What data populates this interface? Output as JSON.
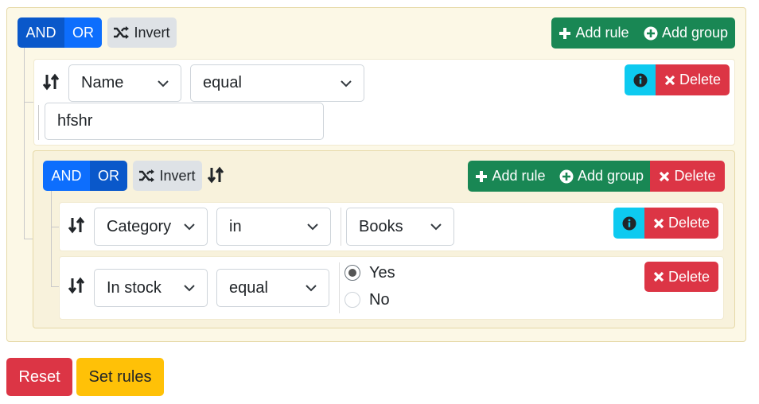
{
  "outer_group": {
    "combinators": [
      "AND",
      "OR"
    ],
    "invert_label": "Invert",
    "add_rule_label": "Add rule",
    "add_group_label": "Add group"
  },
  "rule_1": {
    "field": "Name",
    "operator": "equal",
    "value": "hfshr",
    "delete_label": "Delete"
  },
  "inner_group": {
    "combinators": [
      "AND",
      "OR"
    ],
    "invert_label": "Invert",
    "add_rule_label": "Add rule",
    "add_group_label": "Add group",
    "delete_label": "Delete"
  },
  "rule_2": {
    "field": "Category",
    "operator": "in",
    "value": "Books",
    "delete_label": "Delete"
  },
  "rule_3": {
    "field": "In stock",
    "operator": "equal",
    "options": [
      "Yes",
      "No"
    ],
    "selected": "Yes",
    "delete_label": "Delete"
  },
  "footer": {
    "reset_label": "Reset",
    "set_rules_label": "Set rules"
  },
  "colors": {
    "primary": "#0d6efd",
    "success": "#198754",
    "danger": "#dc3545",
    "info": "#0dcaf0",
    "warning": "#ffc107",
    "group_bg": "#fcf8e6"
  }
}
